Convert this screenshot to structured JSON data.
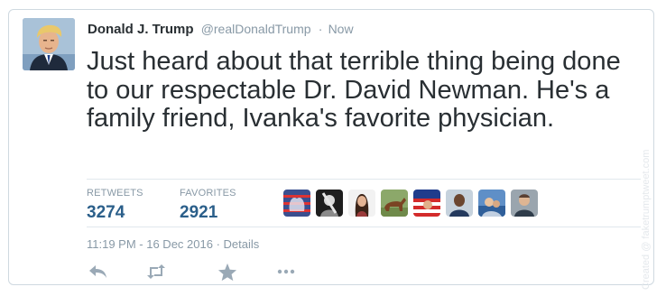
{
  "tweet": {
    "display_name": "Donald J. Trump",
    "handle": "@realDonaldTrump",
    "separator": "·",
    "time_ago": "Now",
    "text": "Just heard about that terrible thing being done to our respectable Dr. David Newman. He's a family friend, Ivanka's favorite physician.",
    "stats": {
      "retweets_label": "RETWEETS",
      "retweets_value": "3274",
      "favorites_label": "FAVORITES",
      "favorites_value": "2921"
    },
    "timestamp": "11:19 PM - 16 Dec 2016",
    "details_link": "· Details",
    "actions": [
      "reply-icon",
      "retweet-icon",
      "favorite-star-icon",
      "more-dots-icon"
    ],
    "favoriters_count_shown": 8
  },
  "watermark": "Created @ faketrumptweet.com",
  "colors": {
    "stat_value": "#2b5f8a",
    "muted": "#8899a6",
    "text": "#292f33",
    "border": "#cfd9e0"
  }
}
